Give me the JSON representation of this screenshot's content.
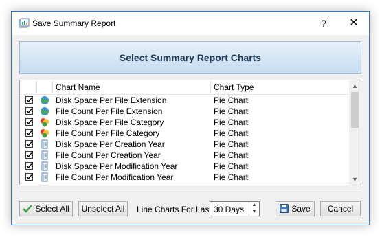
{
  "window": {
    "title": "Save Summary Report",
    "help_glyph": "?",
    "close_glyph": "✕"
  },
  "banner": {
    "heading": "Select Summary Report Charts"
  },
  "list": {
    "columns": [
      "Chart Name",
      "Chart Type"
    ],
    "rows": [
      {
        "checked": true,
        "icon": "globe-icon",
        "name": "Disk Space Per File Extension",
        "type": "Pie Chart"
      },
      {
        "checked": true,
        "icon": "globe-icon",
        "name": "File Count Per File Extension",
        "type": "Pie Chart"
      },
      {
        "checked": true,
        "icon": "category-icon",
        "name": "Disk Space Per File Category",
        "type": "Pie Chart"
      },
      {
        "checked": true,
        "icon": "category-icon",
        "name": "File Count Per File Category",
        "type": "Pie Chart"
      },
      {
        "checked": true,
        "icon": "calendar-icon",
        "name": "Disk Space Per Creation Year",
        "type": "Pie Chart"
      },
      {
        "checked": true,
        "icon": "calendar-icon",
        "name": "File Count Per Creation Year",
        "type": "Pie Chart"
      },
      {
        "checked": true,
        "icon": "calendar-icon",
        "name": "Disk Space Per Modification Year",
        "type": "Pie Chart"
      },
      {
        "checked": true,
        "icon": "calendar-icon",
        "name": "File Count Per Modification Year",
        "type": "Pie Chart"
      }
    ]
  },
  "footer": {
    "select_all_label": "Select All",
    "unselect_all_label": "Unselect All",
    "line_charts_label": "Line Charts For Last:",
    "days_value": "30 Days",
    "save_label": "Save",
    "cancel_label": "Cancel"
  },
  "colors": {
    "accent_border": "#2b79d4",
    "banner_text": "#1f3a5a"
  }
}
